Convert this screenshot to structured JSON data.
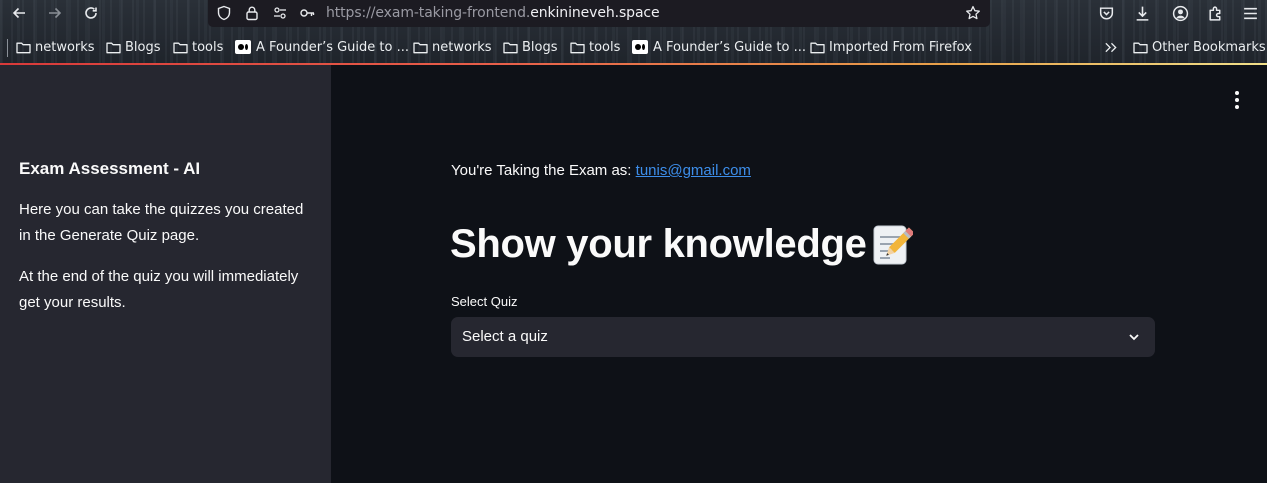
{
  "browser": {
    "url_prefix": "https://exam-taking-frontend.",
    "url_host": "enkinineveh.space",
    "bookmarks": [
      {
        "label": "networks",
        "icon": "folder-icon"
      },
      {
        "label": "Blogs",
        "icon": "folder-icon"
      },
      {
        "label": "tools",
        "icon": "folder-icon"
      },
      {
        "label": "A Founder’s Guide to ...",
        "icon": "medium-icon"
      },
      {
        "label": "networks",
        "icon": "folder-icon"
      },
      {
        "label": "Blogs",
        "icon": "folder-icon"
      },
      {
        "label": "tools",
        "icon": "folder-icon"
      },
      {
        "label": "A Founder’s Guide to ...",
        "icon": "medium-icon"
      },
      {
        "label": "Imported From Firefox",
        "icon": "folder-icon"
      }
    ],
    "overflow_icon": "chevrons-right-icon",
    "other_bookmarks": "Other Bookmarks",
    "accent_colors": [
      "#d93a3a",
      "#e8a24a",
      "#f1e08a"
    ]
  },
  "sidebar": {
    "title": "Exam Assessment - AI",
    "paragraph1": "Here you can take the quizzes you created in the Generate Quiz page.",
    "paragraph2": "At the end of the quiz you will immediately get your results."
  },
  "main": {
    "taking_prefix": "You're Taking the Exam as: ",
    "email": "tunis@gmail.com",
    "headline": "Show your knowledge",
    "headline_icon": "memo-icon",
    "select_label": "Select Quiz",
    "select_value": "Select a quiz",
    "link_color": "#3d8eea",
    "background": "#0e1117",
    "sidebar_background": "#262730"
  }
}
